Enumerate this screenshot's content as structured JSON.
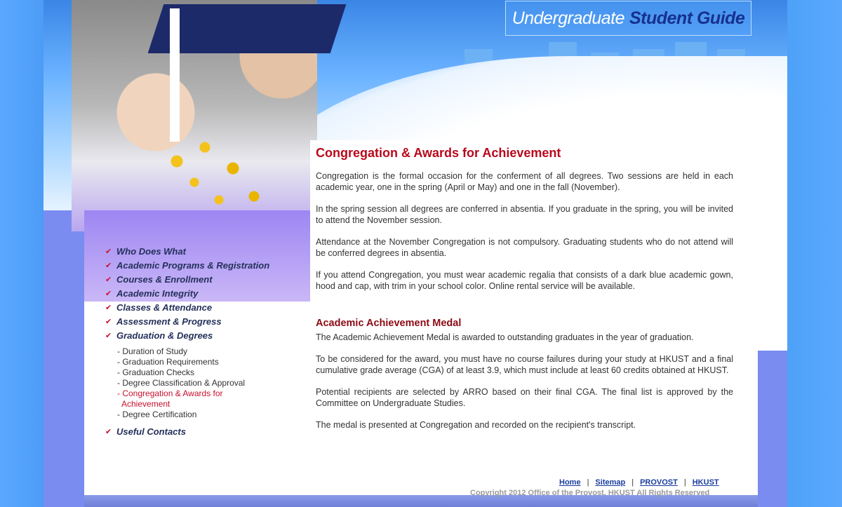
{
  "header": {
    "title_part1": "Undergraduate",
    "title_part2": "Student Guide"
  },
  "nav": {
    "items": [
      {
        "label": "Who Does What"
      },
      {
        "label": "Academic Programs & Registration"
      },
      {
        "label": "Courses & Enrollment"
      },
      {
        "label": "Academic Integrity"
      },
      {
        "label": "Classes & Attendance"
      },
      {
        "label": "Assessment & Progress"
      },
      {
        "label": "Graduation & Degrees"
      }
    ],
    "subitems": [
      {
        "label": "- Duration of Study"
      },
      {
        "label": "- Graduation Requirements"
      },
      {
        "label": "- Graduation Checks"
      },
      {
        "label": "- Degree Classification & Approval"
      },
      {
        "label": "- Congregation & Awards for",
        "label_cont": "Achievement"
      },
      {
        "label": "- Degree Certification"
      }
    ],
    "last_item": "Useful Contacts"
  },
  "main": {
    "title": "Congregation & Awards for Achievement",
    "paragraphs": [
      "Congregation is the formal occasion for the conferment of all degrees. Two sessions are held in each academic year, one in the spring (April or May) and one in the fall (November).",
      "In the spring session all degrees are conferred in absentia. If you graduate in the spring, you will be invited to attend the November session.",
      "Attendance at the November Congregation is not compulsory. Graduating students who do not attend will be conferred degrees in absentia.",
      "If you attend Congregation, you must wear academic regalia that consists of a dark blue academic gown, hood and cap, with trim in your school color. Online rental service will be available."
    ],
    "subtitle": "Academic Achievement Medal",
    "medal_paragraphs": [
      "The Academic Achievement Medal is awarded to outstanding graduates in the year of graduation.",
      "To be considered for the award, you must have no course failures during your study at HKUST and a final cumulative grade average (CGA) of at least 3.9, which must include at least 60 credits obtained at HKUST.",
      "Potential recipients are selected by ARRO based on their final CGA. The final list is approved by the Committee on Undergraduate Studies.",
      "The medal is presented at Congregation and recorded on the recipient's transcript."
    ]
  },
  "footer": {
    "links": [
      "Home",
      "Sitemap",
      "PROVOST",
      "HKUST"
    ],
    "separator": "|",
    "copyright": "Copyright 2012 Office of the Provost, HKUST   All Rights Reserved"
  },
  "colors": {
    "accent_red": "#b8091c",
    "nav_text": "#24305a",
    "link_blue": "#1a3c9e",
    "header_blue": "#17318f"
  }
}
